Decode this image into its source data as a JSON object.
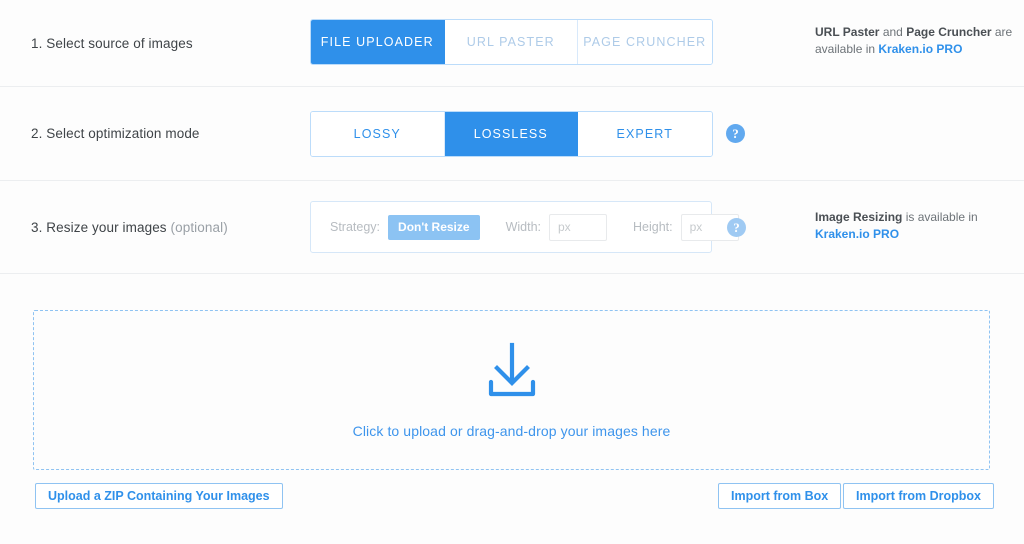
{
  "steps": {
    "source": {
      "label": "1. Select source of images",
      "options": [
        {
          "label": "FILE UPLOADER",
          "state": "active"
        },
        {
          "label": "URL PASTER",
          "state": "disabled"
        },
        {
          "label": "PAGE CRUNCHER",
          "state": "disabled"
        }
      ],
      "note": {
        "strong1": "URL Paster",
        "mid": " and ",
        "strong2": "Page Cruncher",
        "rest": " are available in ",
        "link": "Kraken.io PRO"
      }
    },
    "mode": {
      "label": "2. Select optimization mode",
      "options": [
        {
          "label": "LOSSY",
          "state": "inactive"
        },
        {
          "label": "LOSSLESS",
          "state": "active"
        },
        {
          "label": "EXPERT",
          "state": "inactive"
        }
      ],
      "help": "?"
    },
    "resize": {
      "label_number": "3. Resize your images ",
      "label_optional": "(optional)",
      "strategy_label": "Strategy:",
      "strategy_value": "Don't Resize",
      "width_label": "Width:",
      "width_value": "",
      "width_placeholder": "px",
      "height_label": "Height:",
      "height_value": "",
      "height_placeholder": "px",
      "help": "?",
      "note": {
        "strong1": "Image Resizing",
        "rest": " is available in ",
        "link": "Kraken.io PRO"
      }
    }
  },
  "dropzone": {
    "icon": "download-tray-icon",
    "text": "Click to upload or drag-and-drop your images here"
  },
  "buttons": {
    "zip": "Upload a ZIP Containing Your Images",
    "box": "Import from Box",
    "dropbox": "Import from Dropbox"
  },
  "colors": {
    "accent": "#2f90ea",
    "accent_light": "#8fc3f2",
    "disabled_text": "#aecbe8",
    "border": "#bcdcfa",
    "page_bg": "#fdfdfd"
  }
}
